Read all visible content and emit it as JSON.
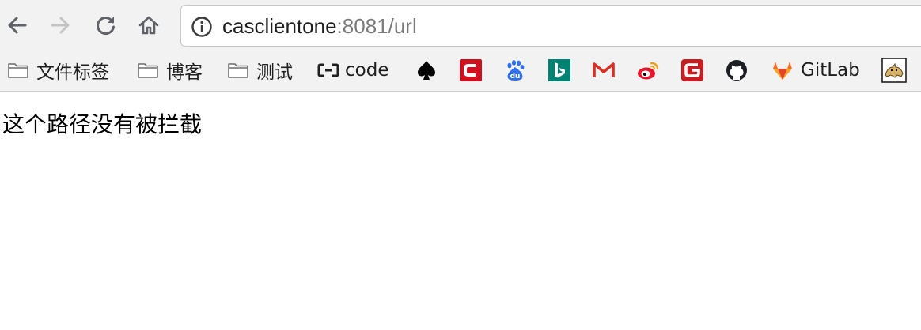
{
  "toolbar": {
    "url_host": "casclientone",
    "url_rest": ":8081/url"
  },
  "bookmarks": [
    {
      "label": "文件标签",
      "icon": "folder-icon"
    },
    {
      "label": "博客",
      "icon": "folder-icon"
    },
    {
      "label": "测试",
      "icon": "folder-icon"
    },
    {
      "label": "code",
      "icon": "alicloud-code-icon"
    },
    {
      "label": "",
      "icon": "spade-icon"
    },
    {
      "label": "",
      "icon": "csdn-icon"
    },
    {
      "label": "",
      "icon": "baidu-icon"
    },
    {
      "label": "",
      "icon": "bing-icon"
    },
    {
      "label": "",
      "icon": "gmail-icon"
    },
    {
      "label": "",
      "icon": "weibo-icon"
    },
    {
      "label": "",
      "icon": "gitee-icon"
    },
    {
      "label": "",
      "icon": "github-icon"
    },
    {
      "label": "GitLab",
      "icon": "gitlab-icon"
    },
    {
      "label": "",
      "icon": "tomcat-icon"
    }
  ],
  "colors": {
    "csdn": "#d0101e",
    "baidu": "#2f6ff1",
    "bing": "#008373",
    "gmail": "#d93025",
    "weibo": "#e6162d",
    "gitee": "#c71d23",
    "gitlab": "#e24329"
  },
  "content": {
    "message": "这个路径没有被拦截"
  }
}
